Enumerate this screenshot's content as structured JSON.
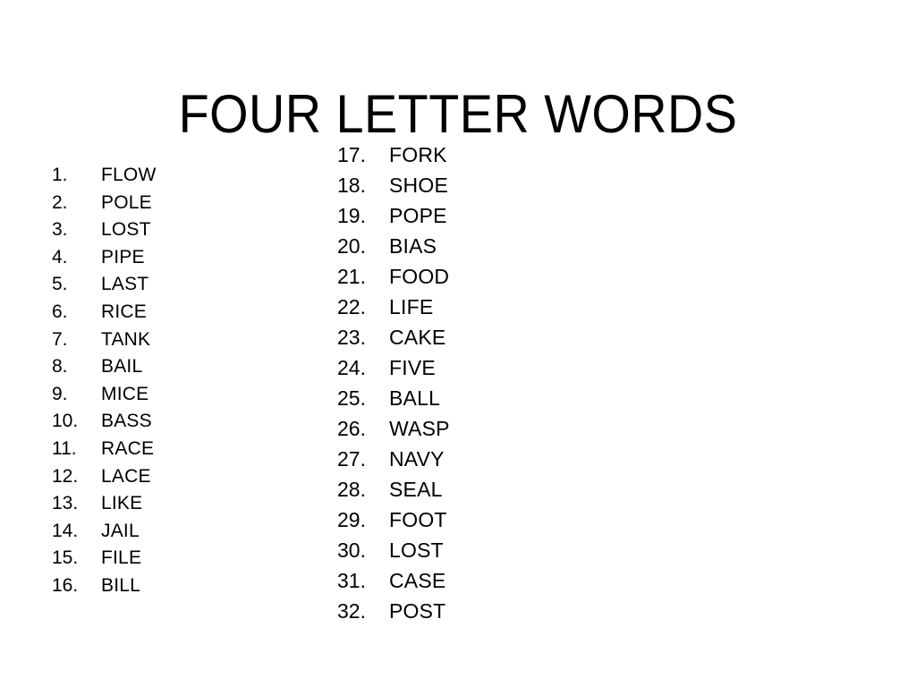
{
  "slide": {
    "title": "FOUR LETTER WORDS",
    "background_color": "#ffffff",
    "text_color": "#000000"
  },
  "columns": [
    {
      "id": "left",
      "items": [
        {
          "number": "1.",
          "word": "FLOW"
        },
        {
          "number": "2.",
          "word": "POLE"
        },
        {
          "number": "3.",
          "word": "LOST"
        },
        {
          "number": "4.",
          "word": "PIPE"
        },
        {
          "number": "5.",
          "word": "LAST"
        },
        {
          "number": "6.",
          "word": "RICE"
        },
        {
          "number": "7.",
          "word": "TANK"
        },
        {
          "number": "8.",
          "word": "BAIL"
        },
        {
          "number": "9.",
          "word": "MICE"
        },
        {
          "number": "10.",
          "word": "BASS"
        },
        {
          "number": "11.",
          "word": "RACE"
        },
        {
          "number": "12.",
          "word": "LACE"
        },
        {
          "number": "13.",
          "word": "LIKE"
        },
        {
          "number": "14.",
          "word": "JAIL"
        },
        {
          "number": "15.",
          "word": "FILE"
        },
        {
          "number": "16.",
          "word": "BILL"
        }
      ]
    },
    {
      "id": "right",
      "items": [
        {
          "number": "17.",
          "word": "FORK"
        },
        {
          "number": "18.",
          "word": "SHOE"
        },
        {
          "number": "19.",
          "word": "POPE"
        },
        {
          "number": "20.",
          "word": "BIAS"
        },
        {
          "number": "21.",
          "word": "FOOD"
        },
        {
          "number": "22.",
          "word": "LIFE"
        },
        {
          "number": "23.",
          "word": "CAKE"
        },
        {
          "number": "24.",
          "word": "FIVE"
        },
        {
          "number": "25.",
          "word": "BALL"
        },
        {
          "number": "26.",
          "word": "WASP"
        },
        {
          "number": "27.",
          "word": "NAVY"
        },
        {
          "number": "28.",
          "word": "SEAL"
        },
        {
          "number": "29.",
          "word": "FOOT"
        },
        {
          "number": "30.",
          "word": "LOST"
        },
        {
          "number": "31.",
          "word": "CASE"
        },
        {
          "number": "32.",
          "word": "POST"
        }
      ]
    }
  ]
}
